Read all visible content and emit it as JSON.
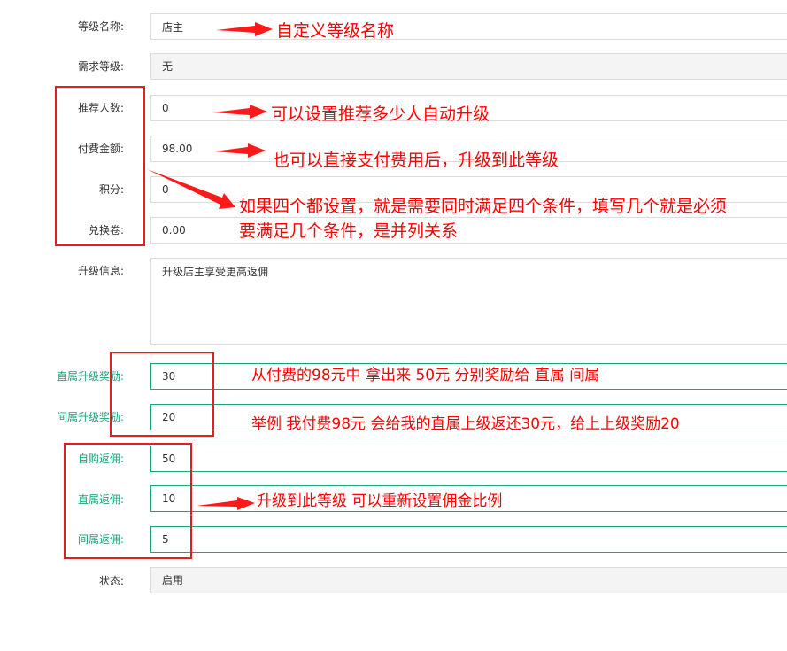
{
  "form": {
    "level_name": {
      "label": "等级名称:",
      "value": "店主"
    },
    "required_level": {
      "label": "需求等级:",
      "value": "无"
    },
    "referrals": {
      "label": "推荐人数:",
      "value": "0"
    },
    "payment": {
      "label": "付费金额:",
      "value": "98.00"
    },
    "points": {
      "label": "积分:",
      "value": "0"
    },
    "voucher": {
      "label": "兑换卷:",
      "value": "0.00"
    },
    "upgrade_info": {
      "label": "升级信息:",
      "value": "升级店主享受更高返佣"
    },
    "direct_upgrade_reward": {
      "label": "直属升级奖励:",
      "value": "30"
    },
    "indirect_upgrade_reward": {
      "label": "间属升级奖励:",
      "value": "20"
    },
    "self_purchase_commission": {
      "label": "自购返佣:",
      "value": "50"
    },
    "direct_commission": {
      "label": "直属返佣:",
      "value": "10"
    },
    "indirect_commission": {
      "label": "间属返佣:",
      "value": "5"
    },
    "status": {
      "label": "状态:",
      "value": "启用"
    }
  },
  "annotations": {
    "custom_name": "自定义等级名称",
    "auto_upgrade": "可以设置推荐多少人自动升级",
    "pay_upgrade": "也可以直接支付费用后，升级到此等级",
    "all_conditions_line1": "如果四个都设置，就是需要同时满足四个条件，填写几个就是必须",
    "all_conditions_line2": "要满足几个条件，是并列关系",
    "reward_split": "从付费的98元中 拿出来  50元  分别奖励给  直属  间属",
    "example": "举例 我付费98元 会给我的直属上级返还30元，给上上级奖励20",
    "reset_commission": "升级到此等级 可以重新设置佣金比例"
  },
  "colors": {
    "annotation": "#ff0000",
    "accent_green": "#1aa37a",
    "border": "#dcdcdc"
  }
}
